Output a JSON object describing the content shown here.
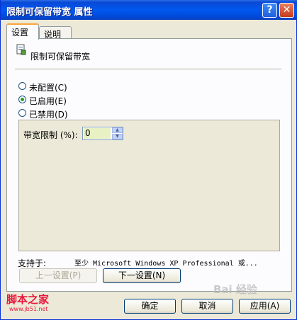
{
  "window": {
    "title": "限制可保留带宽 属性",
    "help_glyph": "?",
    "close_glyph": "✕"
  },
  "tabs": [
    {
      "label": "设置"
    },
    {
      "label": "说明"
    }
  ],
  "policy": {
    "title": "限制可保留带宽"
  },
  "radios": [
    {
      "label": "未配置(C)",
      "selected": false
    },
    {
      "label": "已启用(E)",
      "selected": true
    },
    {
      "label": "已禁用(D)",
      "selected": false
    }
  ],
  "options": {
    "bandwidth_label": "带宽限制 (%):",
    "bandwidth_value": "0"
  },
  "supported": {
    "label": "支持于:",
    "value": "至少 Microsoft Windows XP Professional 或..."
  },
  "nav": {
    "prev_label": "上一设置(P)",
    "next_label": "下一设置(N)"
  },
  "footer": {
    "ok_label": "确定",
    "cancel_label": "取消",
    "apply_label": "应用(A)"
  },
  "watermarks": {
    "left_text": "脚本之家",
    "left_url": "www.jb51.net",
    "right_text": "Bai 经验"
  },
  "colors": {
    "titlebar": "#0058ee",
    "watermark_red": "#e8173b",
    "selected_radio": "#21a121"
  }
}
